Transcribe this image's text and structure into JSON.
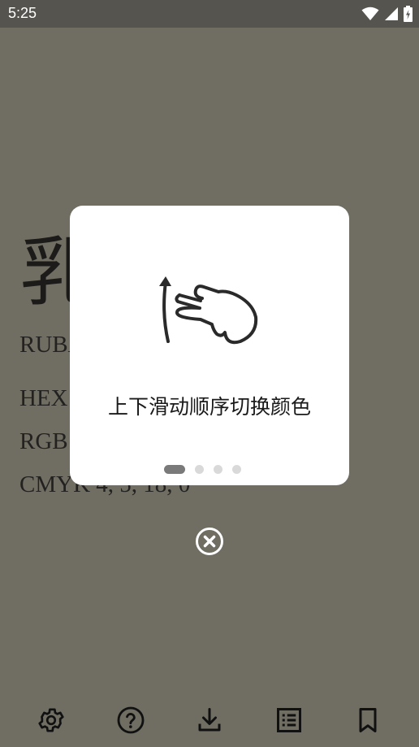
{
  "status_bar": {
    "time": "5:25",
    "icons": [
      "wifi-icon",
      "signal-icon",
      "battery-charging-icon"
    ]
  },
  "background": {
    "big_char": "乳",
    "name_line": "RUBA",
    "hex_line": "HEX",
    "rgb_line": "RGB",
    "cmyk_line": "CMYK 4, 5, 18, 0",
    "color": "#706d62"
  },
  "tutorial": {
    "gesture_icon": "swipe-up-hand-icon",
    "text": "上下滑动顺序切换颜色",
    "page_count": 4,
    "active_page": 1
  },
  "close_icon": "close-circle-icon",
  "bottom_nav": [
    {
      "icon": "settings-icon"
    },
    {
      "icon": "help-icon"
    },
    {
      "icon": "download-icon"
    },
    {
      "icon": "list-icon"
    },
    {
      "icon": "bookmark-icon"
    }
  ]
}
